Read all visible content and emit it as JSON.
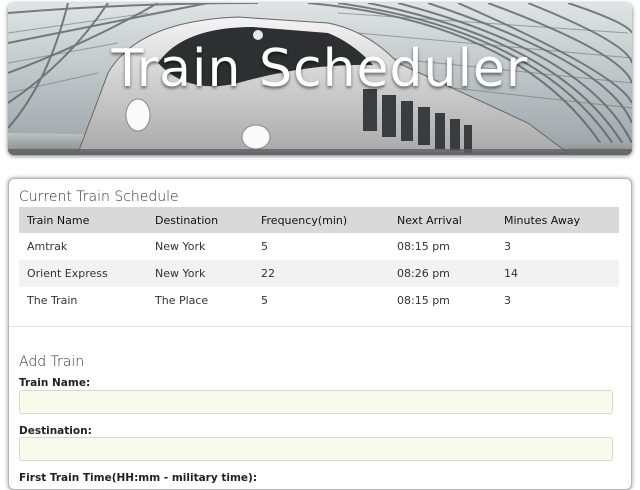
{
  "banner": {
    "title": "Train Scheduler"
  },
  "schedule": {
    "title": "Current Train Schedule",
    "columns": [
      "Train Name",
      "Destination",
      "Frequency(min)",
      "Next Arrival",
      "Minutes Away"
    ],
    "rows": [
      [
        "Amtrak",
        "New York",
        "5",
        "08:15 pm",
        "3"
      ],
      [
        "Orient Express",
        "New York",
        "22",
        "08:26 pm",
        "14"
      ],
      [
        "The Train",
        "The Place",
        "5",
        "08:15 pm",
        "3"
      ]
    ]
  },
  "add_train": {
    "title": "Add Train",
    "train_name_label": "Train Name:",
    "train_name_value": "",
    "destination_label": "Destination:",
    "destination_value": "",
    "first_time_label": "First Train Time(HH:mm - military time):"
  },
  "colors": {
    "input_bg": "#fafaeb",
    "header_bg": "#d9d9d9",
    "alt_row_bg": "#f2f2f2"
  }
}
